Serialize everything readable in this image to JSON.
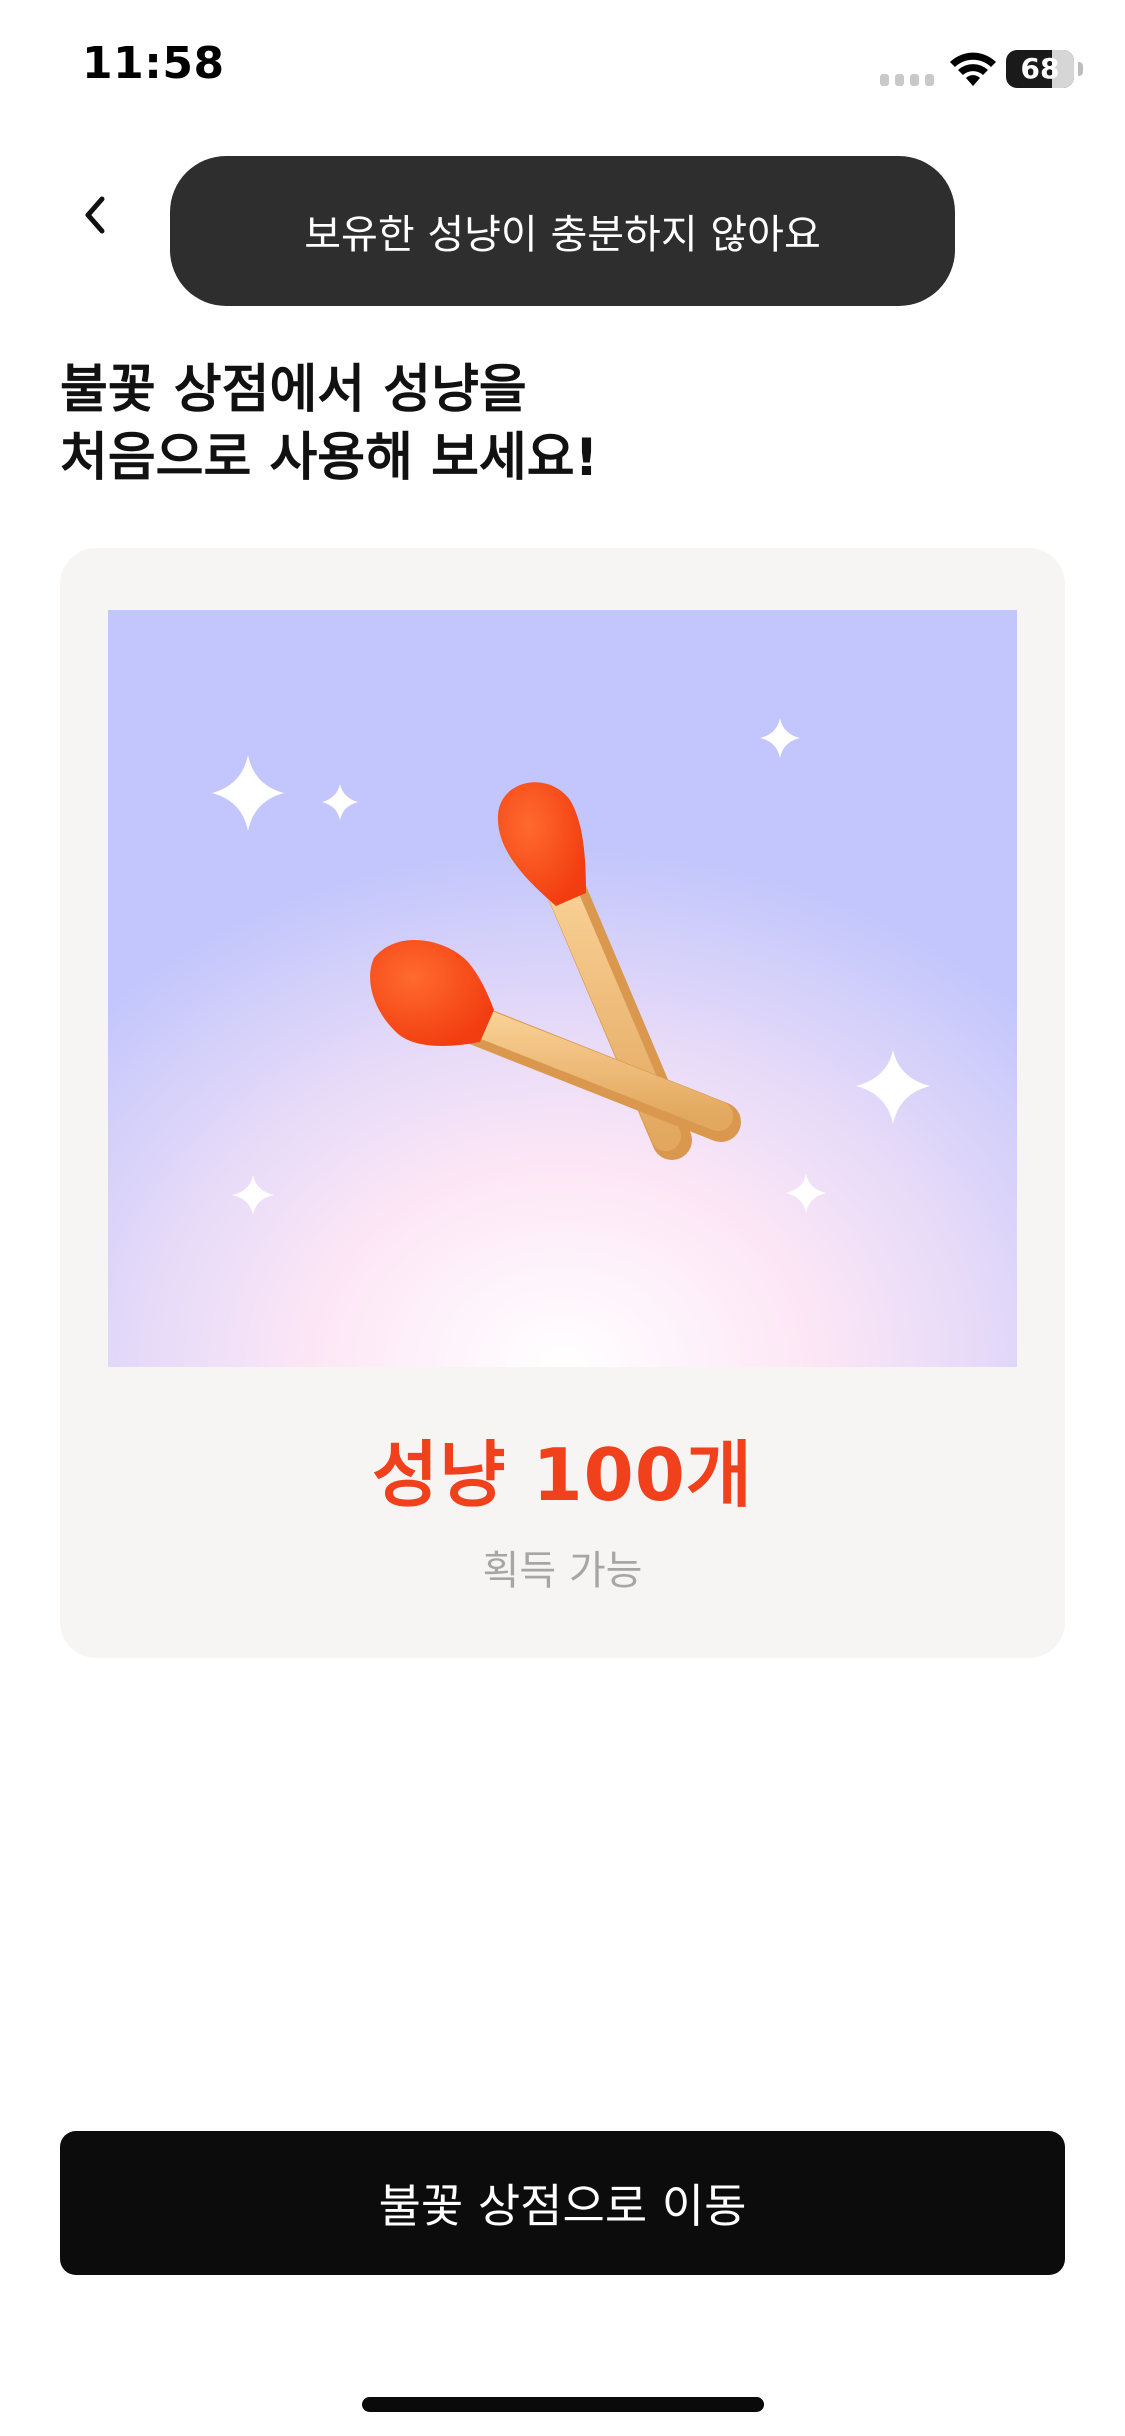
{
  "status_bar": {
    "time": "11:58",
    "battery_level": "68",
    "battery_fraction": 0.68,
    "icons": [
      "cellular-signal-icon",
      "wifi-icon",
      "battery-icon"
    ]
  },
  "header": {
    "back_icon": "chevron-left-icon",
    "toast_message": "보유한 성냥이 충분하지 않아요"
  },
  "headline": {
    "line1": "불꽃 상점에서 성냥을",
    "line2": "처음으로 사용해 보세요!"
  },
  "reward_card": {
    "illustration": "crossed-matches-illustration",
    "amount_text": "성냥 100개",
    "caption": "획득 가능"
  },
  "primary_button": {
    "label": "불꽃 상점으로 이동"
  },
  "colors": {
    "accent_red": "#f0401c",
    "toast_bg": "#2e2e2e",
    "button_bg": "#0c0c0c",
    "card_bg": "#f6f5f3",
    "illustration_sky": "#c2c6fc",
    "caption_gray": "#a6a6a6"
  }
}
